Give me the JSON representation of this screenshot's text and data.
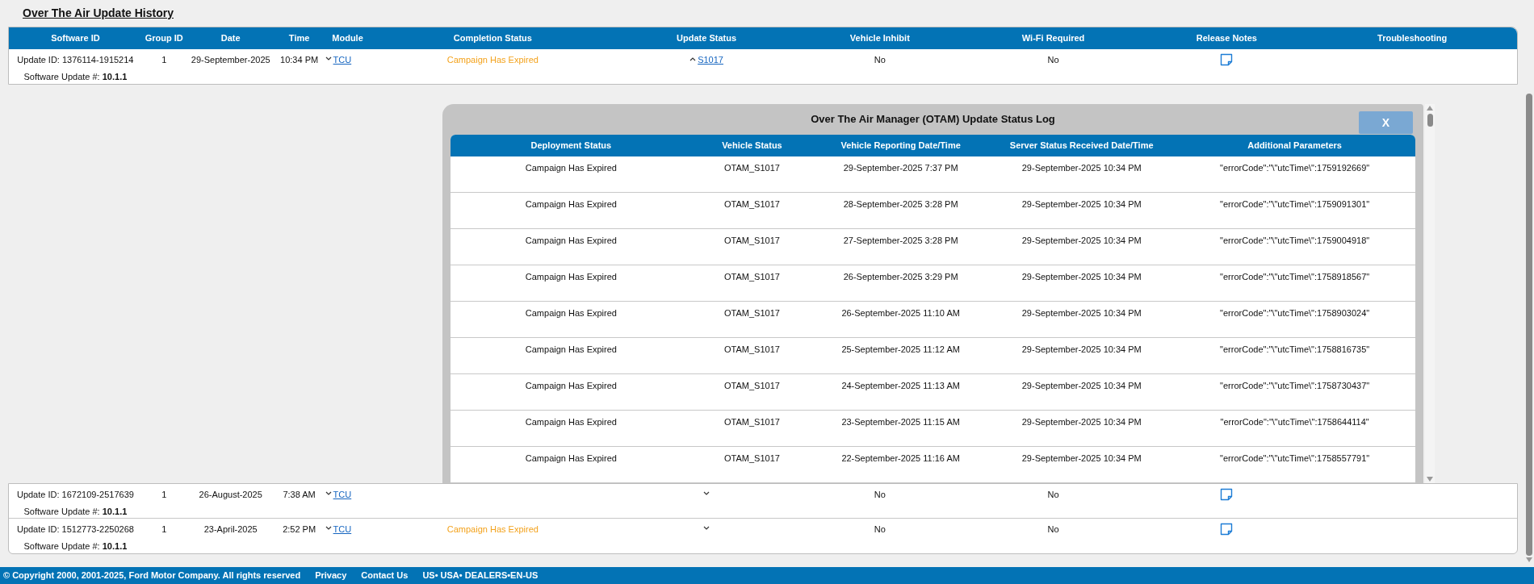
{
  "page_title": "Over The Air Update History",
  "history": {
    "columns": [
      "Software ID",
      "Group ID",
      "Date",
      "Time",
      "Module",
      "Completion Status",
      "Update Status",
      "Vehicle Inhibit",
      "Wi-Fi Required",
      "Release Notes",
      "Troubleshooting"
    ],
    "rows": [
      {
        "software_id": "Update ID: 1376114-1915214",
        "software_update": "Software Update #: **10.1.1**",
        "group_id": "1",
        "date": "29-September-2025",
        "time": "10:34 PM",
        "module": {
          "link": "TCU",
          "expanded": false
        },
        "completion_status": "Campaign Has Expired",
        "update_status": {
          "expanded": true,
          "link": "S1017"
        },
        "vehicle_inhibit": "No",
        "wifi_required": "No"
      },
      {
        "software_id": "Update ID: 1672109-2517639",
        "software_update": "Software Update #: **10.1.1**",
        "group_id": "1",
        "date": "26-August-2025",
        "time": "7:38 AM",
        "module": {
          "link": "TCU",
          "expanded": false
        },
        "update_status": {
          "expanded": false
        },
        "vehicle_inhibit": "No",
        "wifi_required": "No"
      },
      {
        "software_id": "Update ID: 1512773-2250268",
        "software_update": "Software Update #: **10.1.1**",
        "group_id": "1",
        "date": "23-April-2025",
        "time": "2:52 PM",
        "module": {
          "link": "TCU",
          "expanded": false
        },
        "completion_status": "Campaign Has Expired",
        "update_status": {
          "expanded": false
        },
        "vehicle_inhibit": "No",
        "wifi_required": "No"
      }
    ]
  },
  "status_log": {
    "title": "Over The Air Manager (OTAM) Update Status Log",
    "close_label": "X",
    "columns": [
      "Deployment Status",
      "Vehicle Status",
      "Vehicle Reporting Date/Time",
      "Server Status Received Date/Time",
      "Additional Parameters"
    ],
    "rows": [
      [
        "Campaign Has Expired",
        "OTAM_S1017",
        "29-September-2025 7:37 PM",
        "29-September-2025 10:34 PM",
        "\"errorCode\":\"\\\"utcTime\\\":1759192669\""
      ],
      [
        "Campaign Has Expired",
        "OTAM_S1017",
        "28-September-2025 3:28 PM",
        "29-September-2025 10:34 PM",
        "\"errorCode\":\"\\\"utcTime\\\":1759091301\""
      ],
      [
        "Campaign Has Expired",
        "OTAM_S1017",
        "27-September-2025 3:28 PM",
        "29-September-2025 10:34 PM",
        "\"errorCode\":\"\\\"utcTime\\\":1759004918\""
      ],
      [
        "Campaign Has Expired",
        "OTAM_S1017",
        "26-September-2025 3:29 PM",
        "29-September-2025 10:34 PM",
        "\"errorCode\":\"\\\"utcTime\\\":1758918567\""
      ],
      [
        "Campaign Has Expired",
        "OTAM_S1017",
        "26-September-2025 11:10 AM",
        "29-September-2025 10:34 PM",
        "\"errorCode\":\"\\\"utcTime\\\":1758903024\""
      ],
      [
        "Campaign Has Expired",
        "OTAM_S1017",
        "25-September-2025 11:12 AM",
        "29-September-2025 10:34 PM",
        "\"errorCode\":\"\\\"utcTime\\\":1758816735\""
      ],
      [
        "Campaign Has Expired",
        "OTAM_S1017",
        "24-September-2025 11:13 AM",
        "29-September-2025 10:34 PM",
        "\"errorCode\":\"\\\"utcTime\\\":1758730437\""
      ],
      [
        "Campaign Has Expired",
        "OTAM_S1017",
        "23-September-2025 11:15 AM",
        "29-September-2025 10:34 PM",
        "\"errorCode\":\"\\\"utcTime\\\":1758644114\""
      ],
      [
        "Campaign Has Expired",
        "OTAM_S1017",
        "22-September-2025 11:16 AM",
        "29-September-2025 10:34 PM",
        "\"errorCode\":\"\\\"utcTime\\\":1758557791\""
      ]
    ]
  },
  "footer": {
    "copyright": "© Copyright 2000, 2001-2025, Ford Motor Company. All rights reserved",
    "links": [
      "Privacy",
      "Contact Us"
    ],
    "locale": "US• USA• DEALERS•EN-US"
  }
}
